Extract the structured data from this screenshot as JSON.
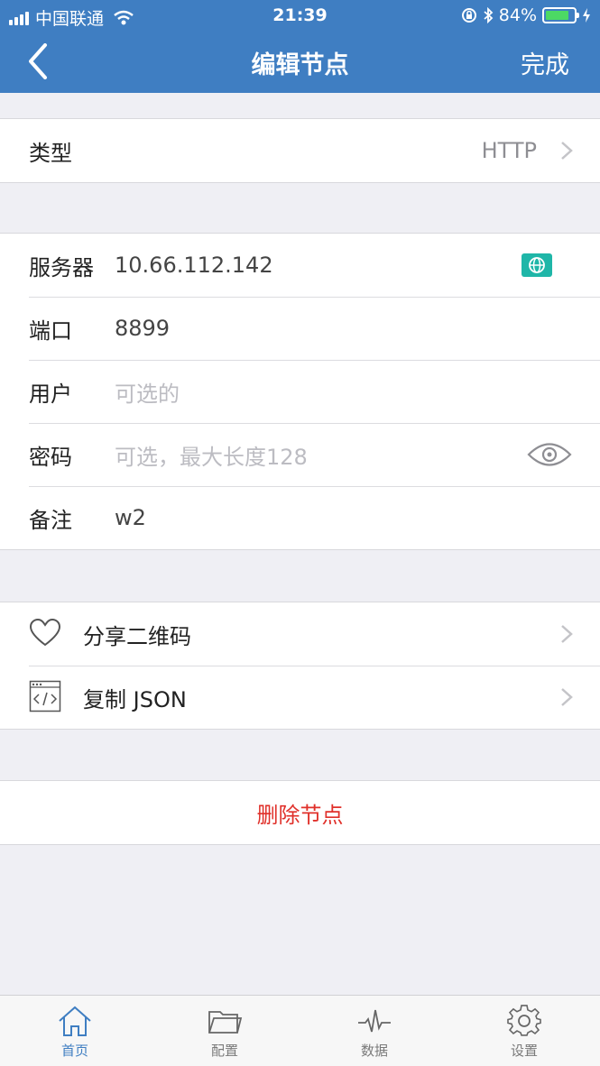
{
  "status_bar": {
    "carrier": "中国联通",
    "time": "21:39",
    "battery": "84%",
    "battery_level": 0.84
  },
  "nav": {
    "title": "编辑节点",
    "done_label": "完成"
  },
  "type_row": {
    "label": "类型",
    "value": "HTTP"
  },
  "fields": {
    "server": {
      "label": "服务器",
      "value": "10.66.112.142"
    },
    "port": {
      "label": "端口",
      "value": "8899"
    },
    "user": {
      "label": "用户",
      "placeholder": "可选的"
    },
    "password": {
      "label": "密码",
      "placeholder": "可选，最大长度128"
    },
    "remark": {
      "label": "备注",
      "value": "w2"
    }
  },
  "actions": {
    "share_qr": "分享二维码",
    "copy_json": "复制 JSON"
  },
  "delete_label": "删除节点",
  "tabs": [
    {
      "label": "首页",
      "icon": "home-icon",
      "active": true
    },
    {
      "label": "配置",
      "icon": "folder-icon",
      "active": false
    },
    {
      "label": "数据",
      "icon": "activity-icon",
      "active": false
    },
    {
      "label": "设置",
      "icon": "gear-icon",
      "active": false
    }
  ],
  "colors": {
    "accent": "#3f7ec2",
    "danger": "#e0302a",
    "battery": "#4cd964",
    "globe": "#1fb6a8"
  }
}
